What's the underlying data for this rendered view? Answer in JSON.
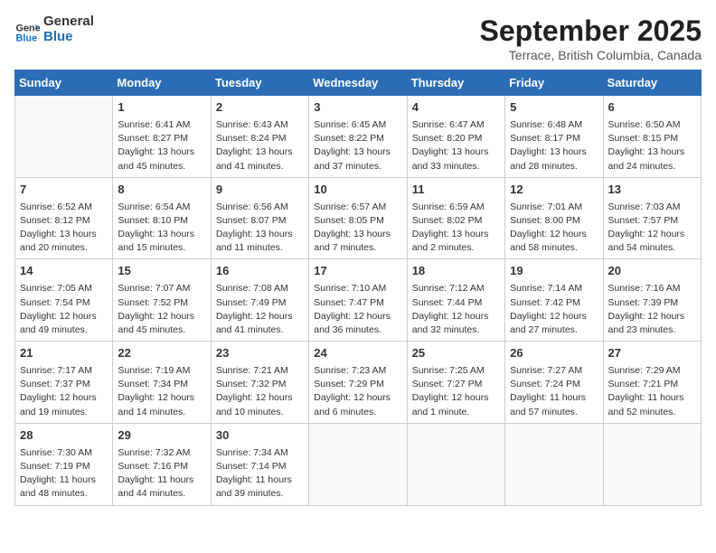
{
  "logo": {
    "line1": "General",
    "line2": "Blue"
  },
  "title": "September 2025",
  "subtitle": "Terrace, British Columbia, Canada",
  "days_of_week": [
    "Sunday",
    "Monday",
    "Tuesday",
    "Wednesday",
    "Thursday",
    "Friday",
    "Saturday"
  ],
  "weeks": [
    [
      {
        "num": "",
        "info": ""
      },
      {
        "num": "1",
        "info": "Sunrise: 6:41 AM\nSunset: 8:27 PM\nDaylight: 13 hours\nand 45 minutes."
      },
      {
        "num": "2",
        "info": "Sunrise: 6:43 AM\nSunset: 8:24 PM\nDaylight: 13 hours\nand 41 minutes."
      },
      {
        "num": "3",
        "info": "Sunrise: 6:45 AM\nSunset: 8:22 PM\nDaylight: 13 hours\nand 37 minutes."
      },
      {
        "num": "4",
        "info": "Sunrise: 6:47 AM\nSunset: 8:20 PM\nDaylight: 13 hours\nand 33 minutes."
      },
      {
        "num": "5",
        "info": "Sunrise: 6:48 AM\nSunset: 8:17 PM\nDaylight: 13 hours\nand 28 minutes."
      },
      {
        "num": "6",
        "info": "Sunrise: 6:50 AM\nSunset: 8:15 PM\nDaylight: 13 hours\nand 24 minutes."
      }
    ],
    [
      {
        "num": "7",
        "info": "Sunrise: 6:52 AM\nSunset: 8:12 PM\nDaylight: 13 hours\nand 20 minutes."
      },
      {
        "num": "8",
        "info": "Sunrise: 6:54 AM\nSunset: 8:10 PM\nDaylight: 13 hours\nand 15 minutes."
      },
      {
        "num": "9",
        "info": "Sunrise: 6:56 AM\nSunset: 8:07 PM\nDaylight: 13 hours\nand 11 minutes."
      },
      {
        "num": "10",
        "info": "Sunrise: 6:57 AM\nSunset: 8:05 PM\nDaylight: 13 hours\nand 7 minutes."
      },
      {
        "num": "11",
        "info": "Sunrise: 6:59 AM\nSunset: 8:02 PM\nDaylight: 13 hours\nand 2 minutes."
      },
      {
        "num": "12",
        "info": "Sunrise: 7:01 AM\nSunset: 8:00 PM\nDaylight: 12 hours\nand 58 minutes."
      },
      {
        "num": "13",
        "info": "Sunrise: 7:03 AM\nSunset: 7:57 PM\nDaylight: 12 hours\nand 54 minutes."
      }
    ],
    [
      {
        "num": "14",
        "info": "Sunrise: 7:05 AM\nSunset: 7:54 PM\nDaylight: 12 hours\nand 49 minutes."
      },
      {
        "num": "15",
        "info": "Sunrise: 7:07 AM\nSunset: 7:52 PM\nDaylight: 12 hours\nand 45 minutes."
      },
      {
        "num": "16",
        "info": "Sunrise: 7:08 AM\nSunset: 7:49 PM\nDaylight: 12 hours\nand 41 minutes."
      },
      {
        "num": "17",
        "info": "Sunrise: 7:10 AM\nSunset: 7:47 PM\nDaylight: 12 hours\nand 36 minutes."
      },
      {
        "num": "18",
        "info": "Sunrise: 7:12 AM\nSunset: 7:44 PM\nDaylight: 12 hours\nand 32 minutes."
      },
      {
        "num": "19",
        "info": "Sunrise: 7:14 AM\nSunset: 7:42 PM\nDaylight: 12 hours\nand 27 minutes."
      },
      {
        "num": "20",
        "info": "Sunrise: 7:16 AM\nSunset: 7:39 PM\nDaylight: 12 hours\nand 23 minutes."
      }
    ],
    [
      {
        "num": "21",
        "info": "Sunrise: 7:17 AM\nSunset: 7:37 PM\nDaylight: 12 hours\nand 19 minutes."
      },
      {
        "num": "22",
        "info": "Sunrise: 7:19 AM\nSunset: 7:34 PM\nDaylight: 12 hours\nand 14 minutes."
      },
      {
        "num": "23",
        "info": "Sunrise: 7:21 AM\nSunset: 7:32 PM\nDaylight: 12 hours\nand 10 minutes."
      },
      {
        "num": "24",
        "info": "Sunrise: 7:23 AM\nSunset: 7:29 PM\nDaylight: 12 hours\nand 6 minutes."
      },
      {
        "num": "25",
        "info": "Sunrise: 7:25 AM\nSunset: 7:27 PM\nDaylight: 12 hours\nand 1 minute."
      },
      {
        "num": "26",
        "info": "Sunrise: 7:27 AM\nSunset: 7:24 PM\nDaylight: 11 hours\nand 57 minutes."
      },
      {
        "num": "27",
        "info": "Sunrise: 7:29 AM\nSunset: 7:21 PM\nDaylight: 11 hours\nand 52 minutes."
      }
    ],
    [
      {
        "num": "28",
        "info": "Sunrise: 7:30 AM\nSunset: 7:19 PM\nDaylight: 11 hours\nand 48 minutes."
      },
      {
        "num": "29",
        "info": "Sunrise: 7:32 AM\nSunset: 7:16 PM\nDaylight: 11 hours\nand 44 minutes."
      },
      {
        "num": "30",
        "info": "Sunrise: 7:34 AM\nSunset: 7:14 PM\nDaylight: 11 hours\nand 39 minutes."
      },
      {
        "num": "",
        "info": ""
      },
      {
        "num": "",
        "info": ""
      },
      {
        "num": "",
        "info": ""
      },
      {
        "num": "",
        "info": ""
      }
    ]
  ]
}
